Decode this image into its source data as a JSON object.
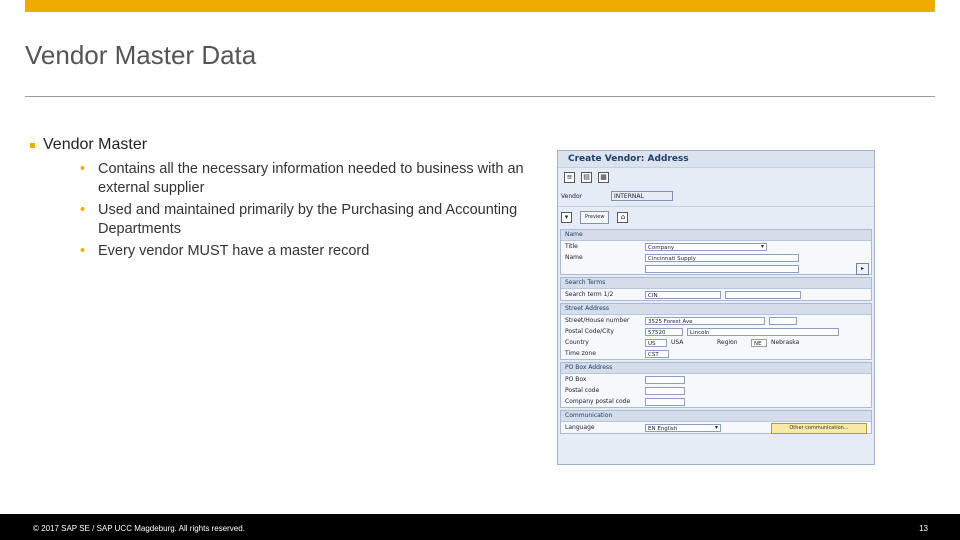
{
  "slide": {
    "title": "Vendor Master Data",
    "bullet": "Vendor Master",
    "subbullets": [
      "Contains all the necessary information needed to business with an external supplier",
      "Used and maintained primarily by the  Purchasing and Accounting Departments",
      "Every vendor MUST have a master record"
    ],
    "footer_copyright": "© 2017 SAP SE / SAP UCC Magdeburg. All rights reserved.",
    "page_number": "13",
    "accent_color": "#f0ab00"
  },
  "sap": {
    "window_title": "Create Vendor: Address",
    "vendor_label": "Vendor",
    "vendor_value": "INTERNAL",
    "preview_button": "Preview",
    "sections": {
      "name": {
        "header": "Name",
        "title_label": "Title",
        "title_value": "Company",
        "name_label": "Name",
        "name_value": "Cincinnati Supply"
      },
      "search": {
        "header": "Search Terms",
        "term_label": "Search term 1/2",
        "term_value": "CIN"
      },
      "street": {
        "header": "Street Address",
        "street_label": "Street/House number",
        "street_value": "3525 Forest Ave",
        "postal_label": "Postal Code/City",
        "postal_value": "57520",
        "city_value": "Lincoln",
        "country_label": "Country",
        "country_value": "US",
        "country_text": "USA",
        "region_label": "Region",
        "region_value": "NE",
        "region_text": "Nebraska",
        "timezone_label": "Time zone",
        "timezone_value": "CST"
      },
      "pobox": {
        "header": "PO Box Address",
        "pobox_label": "PO Box",
        "postal_label": "Postal code",
        "company_postal_label": "Company postal code"
      },
      "communication": {
        "header": "Communication",
        "language_label": "Language",
        "language_value": "EN English",
        "other_button": "Other communication..."
      }
    }
  }
}
